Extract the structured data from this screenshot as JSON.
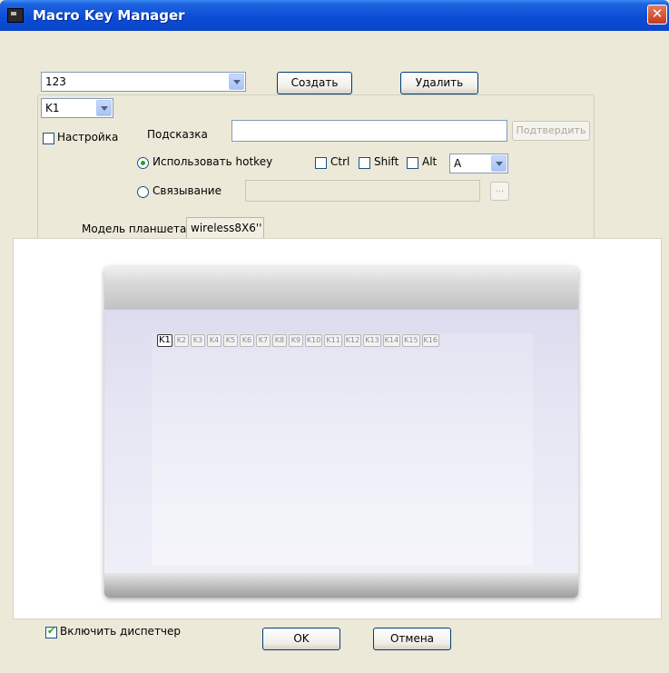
{
  "window": {
    "title": "Macro Key Manager"
  },
  "macro": {
    "profile_value": "123",
    "create_label": "Создать",
    "delete_label": "Удалить",
    "key_value": "K1",
    "settings_label": "Настройка",
    "hint_label": "Подсказка",
    "hint_value": "",
    "confirm_label": "Подтвердить",
    "use_hotkey_label": "Использовать hotkey",
    "ctrl_label": "Ctrl",
    "shift_label": "Shift",
    "alt_label": "Alt",
    "hotkey_value": "A",
    "binding_label": "Связывание",
    "binding_value": "",
    "browse_label": "..."
  },
  "model": {
    "label": "Модель планшета",
    "value": "wireless8X6''"
  },
  "tablet": {
    "keys": [
      "K1",
      "K2",
      "K3",
      "K4",
      "K5",
      "K6",
      "K7",
      "K8",
      "K9",
      "K10",
      "K11",
      "K12",
      "K13",
      "K14",
      "K15",
      "K16"
    ],
    "active_key": "K1"
  },
  "footer": {
    "enable_label": "Включить диспетчер",
    "ok_label": "OK",
    "cancel_label": "Отмена"
  }
}
